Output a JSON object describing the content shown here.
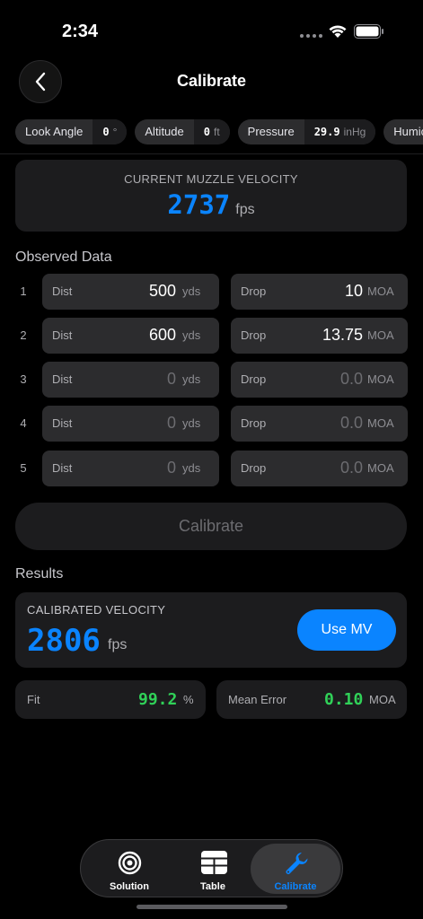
{
  "status": {
    "time": "2:34"
  },
  "nav": {
    "title": "Calibrate"
  },
  "chips": [
    {
      "label": "Look Angle",
      "value": "0",
      "unit": "°"
    },
    {
      "label": "Altitude",
      "value": "0",
      "unit": "ft"
    },
    {
      "label": "Pressure",
      "value": "29.9",
      "unit": "inHg"
    },
    {
      "label": "Humic",
      "value": "",
      "unit": ""
    }
  ],
  "muzzle": {
    "caption": "CURRENT MUZZLE VELOCITY",
    "value": "2737",
    "unit": "fps"
  },
  "observed": {
    "title": "Observed Data",
    "rows": [
      {
        "index": "1",
        "dist_label": "Dist",
        "dist": "500",
        "dist_unit": "yds",
        "drop_label": "Drop",
        "drop": "10",
        "drop_unit": "MOA",
        "empty": false
      },
      {
        "index": "2",
        "dist_label": "Dist",
        "dist": "600",
        "dist_unit": "yds",
        "drop_label": "Drop",
        "drop": "13.75",
        "drop_unit": "MOA",
        "empty": false
      },
      {
        "index": "3",
        "dist_label": "Dist",
        "dist": "0",
        "dist_unit": "yds",
        "drop_label": "Drop",
        "drop": "0.0",
        "drop_unit": "MOA",
        "empty": true
      },
      {
        "index": "4",
        "dist_label": "Dist",
        "dist": "0",
        "dist_unit": "yds",
        "drop_label": "Drop",
        "drop": "0.0",
        "drop_unit": "MOA",
        "empty": true
      },
      {
        "index": "5",
        "dist_label": "Dist",
        "dist": "0",
        "dist_unit": "yds",
        "drop_label": "Drop",
        "drop": "0.0",
        "drop_unit": "MOA",
        "empty": true
      }
    ]
  },
  "calibrate_button": "Calibrate",
  "results": {
    "title": "Results",
    "caption": "CALIBRATED VELOCITY",
    "value": "2806",
    "unit": "fps",
    "use_mv": "Use MV",
    "fit_label": "Fit",
    "fit_value": "99.2",
    "fit_unit": "%",
    "error_label": "Mean Error",
    "error_value": "0.10",
    "error_unit": "MOA"
  },
  "tabs": [
    {
      "label": "Solution",
      "icon": "target-icon",
      "active": false
    },
    {
      "label": "Table",
      "icon": "table-icon",
      "active": false
    },
    {
      "label": "Calibrate",
      "icon": "wrench-icon",
      "active": true
    }
  ],
  "colors": {
    "accent": "#0a84ff",
    "positive": "#30d158",
    "background": "#000000",
    "card": "#1c1c1e"
  }
}
